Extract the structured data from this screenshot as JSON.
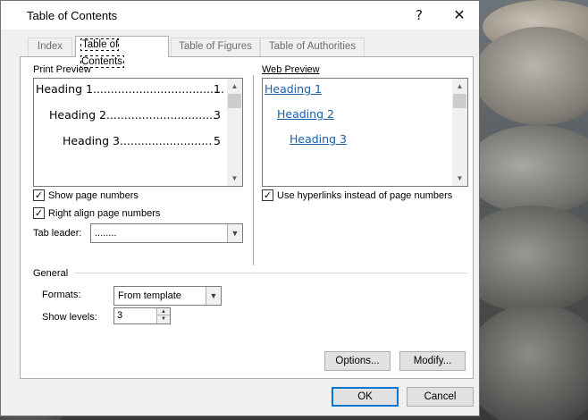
{
  "window": {
    "title": "Table of Contents",
    "help": "?",
    "close": "✕"
  },
  "tabs": [
    {
      "label": "Index"
    },
    {
      "label": "Table of Contents"
    },
    {
      "label": "Table of Figures"
    },
    {
      "label": "Table of Authorities"
    }
  ],
  "print_preview": {
    "label": "Print Preview",
    "lines": [
      {
        "text": "Heading 1.....................................",
        "page": "1"
      },
      {
        "text": "Heading 2...............................",
        "page": "3"
      },
      {
        "text": "Heading 3..........................",
        "page": "5"
      }
    ]
  },
  "web_preview": {
    "label": "Web Preview",
    "links": [
      "Heading 1",
      "Heading 2",
      "Heading 3"
    ]
  },
  "options": {
    "show_page_numbers": {
      "label": "Show page numbers",
      "checked": true
    },
    "right_align": {
      "label": "Right align page numbers",
      "checked": true
    },
    "use_hyperlinks": {
      "label": "Use hyperlinks instead of page numbers",
      "checked": true
    },
    "tab_leader": {
      "label": "Tab leader:",
      "value": "........"
    }
  },
  "general": {
    "label": "General",
    "formats": {
      "label": "Formats:",
      "value": "From template"
    },
    "show_levels": {
      "label": "Show levels:",
      "value": "3"
    }
  },
  "buttons": {
    "options": "Options...",
    "modify": "Modify...",
    "ok": "OK",
    "cancel": "Cancel"
  },
  "icons": {
    "check": "✓",
    "scroll_up": "▲",
    "scroll_down": "▼",
    "dropdown": "▼",
    "spin_up": "▲",
    "spin_down": "▼"
  }
}
